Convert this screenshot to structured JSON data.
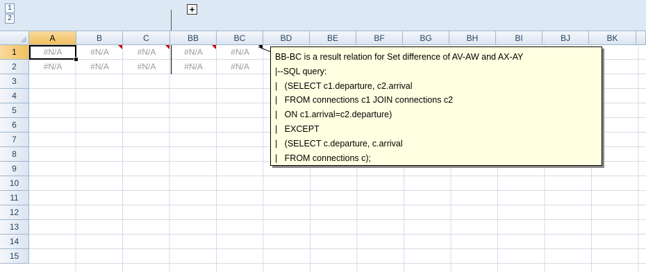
{
  "outline": {
    "levels": [
      "1",
      "2"
    ],
    "expand_button": "+"
  },
  "columns": [
    {
      "id": "col-a",
      "label": "A",
      "selected": true
    },
    {
      "id": "col-b",
      "label": "B",
      "selected": false
    },
    {
      "id": "col-c",
      "label": "C",
      "selected": false
    },
    {
      "id": "col-bb",
      "label": "BB",
      "selected": false
    },
    {
      "id": "col-bc",
      "label": "BC",
      "selected": false
    },
    {
      "id": "col-bd",
      "label": "BD",
      "selected": false
    },
    {
      "id": "col-be",
      "label": "BE",
      "selected": false
    },
    {
      "id": "col-bf",
      "label": "BF",
      "selected": false
    },
    {
      "id": "col-bg",
      "label": "BG",
      "selected": false
    },
    {
      "id": "col-bh",
      "label": "BH",
      "selected": false
    },
    {
      "id": "col-bi",
      "label": "BI",
      "selected": false
    },
    {
      "id": "col-bj",
      "label": "BJ",
      "selected": false
    },
    {
      "id": "col-bk",
      "label": "BK",
      "selected": false
    }
  ],
  "rows": [
    "1",
    "2",
    "3",
    "4",
    "5",
    "6",
    "7",
    "8",
    "9",
    "10",
    "11",
    "12",
    "13",
    "14",
    "15"
  ],
  "cells": {
    "row1": [
      "#N/A",
      "#N/A",
      "#N/A",
      "#N/A",
      "#N/A"
    ],
    "row2": [
      "#N/A",
      "#N/A",
      "#N/A",
      "#N/A",
      "#N/A"
    ]
  },
  "comment": {
    "lines": [
      "BB-BC is a result relation for Set difference of AV-AW and AX-AY",
      "|--SQL query:",
      "|   (SELECT c1.departure, c2.arrival",
      "|   FROM connections c1 JOIN connections c2",
      "|   ON c1.arrival=c2.departure)",
      "|   EXCEPT",
      "|   (SELECT c.departure, c.arrival",
      "|   FROM connections c);"
    ]
  },
  "colors": {
    "header_bg": "#dbe5f1",
    "selected_header": "#f1c15f",
    "comment_bg": "#ffffe1",
    "comment_indicator": "#d40000",
    "na_text": "#9a9a9a"
  }
}
